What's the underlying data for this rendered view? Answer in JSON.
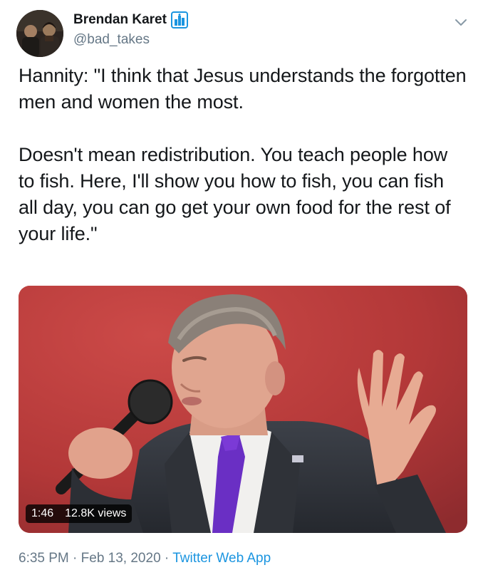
{
  "tweet": {
    "author_name": "Brendan Karet",
    "author_handle": "@bad_takes",
    "badge_icon": "building-icon",
    "menu_icon": "chevron-down-icon",
    "text": "Hannity: \"I think that Jesus understands the forgotten men and women the most.\n\nDoesn't mean redistribution. You teach people how to fish. Here, I'll show you how to fish, you can fish all day, you can go get your own food for the rest of your life.\"",
    "media": {
      "duration": "1:46",
      "views": "12.8K views"
    },
    "time": "6:35 PM",
    "separator": "·",
    "date": "Feb 13, 2020",
    "source": "Twitter Web App"
  },
  "colors": {
    "text": "#14171a",
    "muted": "#657786",
    "link": "#1b95e0",
    "badge": "#1b95e0",
    "video_bg": "#b8393a"
  }
}
